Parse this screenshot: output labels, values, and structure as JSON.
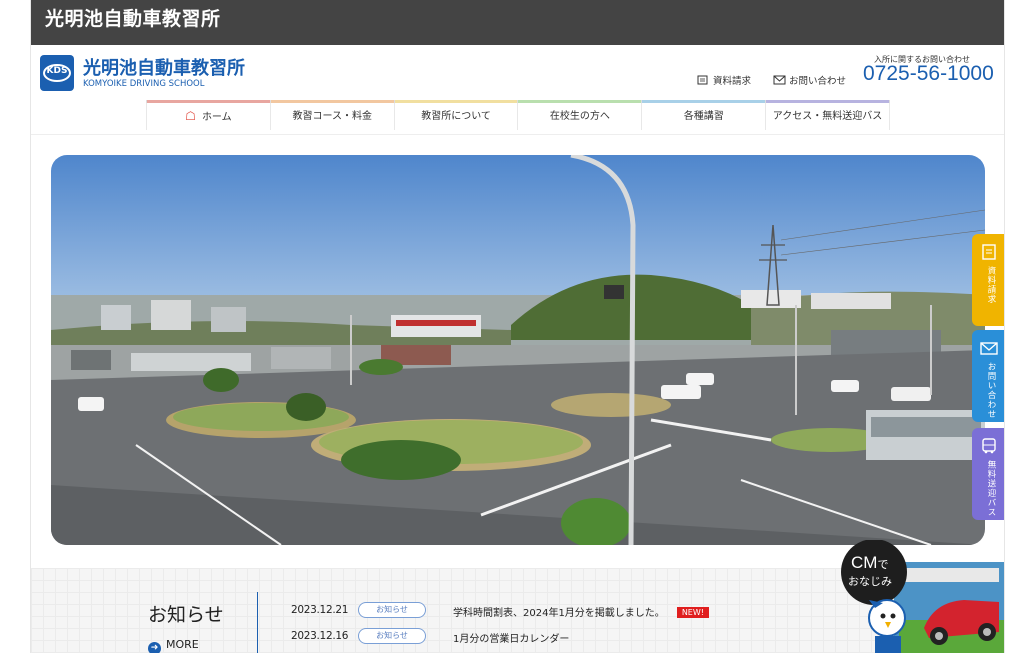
{
  "window": {
    "title": "光明池自動車教習所"
  },
  "header": {
    "logo_mark": "KDS",
    "logo_name": "光明池自動車教習所",
    "logo_en": "KOMYOIKE DRIVING SCHOOL",
    "brochure_link": "資料請求",
    "contact_link": "お問い合わせ",
    "inquiry_label": "入所に関するお問い合わせ",
    "phone": "0725-56-1000"
  },
  "nav": {
    "items": [
      {
        "label": "ホーム",
        "color": "#e8a6a0"
      },
      {
        "label": "教習コース・料金",
        "color": "#f2c7a0"
      },
      {
        "label": "教習所について",
        "color": "#f1dfa0"
      },
      {
        "label": "在校生の方へ",
        "color": "#b9dfae"
      },
      {
        "label": "各種講習",
        "color": "#a8d0e8"
      },
      {
        "label": "アクセス・無料送迎バス",
        "color": "#b7b3e0"
      }
    ]
  },
  "side_tabs": [
    {
      "label": "資料請求",
      "color": "#f0b400",
      "icon": "document-icon"
    },
    {
      "label": "お問い合わせ",
      "color": "#2a8fd8",
      "icon": "mail-icon"
    },
    {
      "label": "無料送迎バス",
      "color": "#7b6fd6",
      "icon": "bus-icon"
    }
  ],
  "news": {
    "title": "お知らせ",
    "more_label": "MORE",
    "items": [
      {
        "date": "2023.12.21",
        "tag": "お知らせ",
        "text": "学科時間割表、2024年1月分を掲載しました。",
        "badge": "NEW!"
      },
      {
        "date": "2023.12.16",
        "tag": "お知らせ",
        "text": "1月分の営業日カレンダー",
        "badge": ""
      }
    ]
  },
  "cm_banner": {
    "line1": "CM",
    "line1b": "で",
    "line2": "おなじみ"
  }
}
